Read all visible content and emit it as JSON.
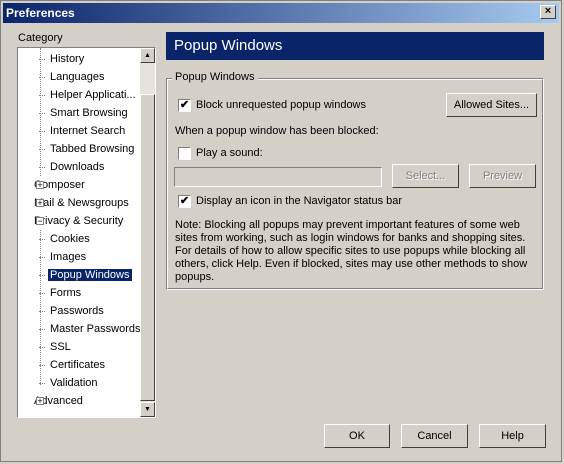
{
  "window": {
    "title": "Preferences",
    "close_glyph": "×"
  },
  "category_label": "Category",
  "tree": [
    {
      "label": "History",
      "level": 1,
      "selected": false
    },
    {
      "label": "Languages",
      "level": 1,
      "selected": false
    },
    {
      "label": "Helper Applicati...",
      "level": 1,
      "selected": false
    },
    {
      "label": "Smart Browsing",
      "level": 1,
      "selected": false
    },
    {
      "label": "Internet Search",
      "level": 1,
      "selected": false
    },
    {
      "label": "Tabbed Browsing",
      "level": 1,
      "selected": false
    },
    {
      "label": "Downloads",
      "level": 1,
      "selected": false
    },
    {
      "label": "Composer",
      "level": 0,
      "expander": "+",
      "selected": false
    },
    {
      "label": "Mail & Newsgroups",
      "level": 0,
      "expander": "+",
      "selected": false
    },
    {
      "label": "Privacy & Security",
      "level": 0,
      "expander": "−",
      "selected": false
    },
    {
      "label": "Cookies",
      "level": 1,
      "selected": false
    },
    {
      "label": "Images",
      "level": 1,
      "selected": false
    },
    {
      "label": "Popup Windows",
      "level": 1,
      "selected": true
    },
    {
      "label": "Forms",
      "level": 1,
      "selected": false
    },
    {
      "label": "Passwords",
      "level": 1,
      "selected": false
    },
    {
      "label": "Master Passwords",
      "level": 1,
      "selected": false
    },
    {
      "label": "SSL",
      "level": 1,
      "selected": false
    },
    {
      "label": "Certificates",
      "level": 1,
      "selected": false
    },
    {
      "label": "Validation",
      "level": 1,
      "selected": false
    },
    {
      "label": "Advanced",
      "level": 0,
      "expander": "+",
      "selected": false
    }
  ],
  "scroll": {
    "up_glyph": "▲",
    "down_glyph": "▼"
  },
  "panel": {
    "title": "Popup Windows",
    "group_title": "Popup Windows",
    "block_popups": {
      "label": "Block unrequested popup windows",
      "checked": true,
      "check_glyph": "✔"
    },
    "allowed_sites_button": "Allowed Sites...",
    "when_blocked_label": "When a popup window has been blocked:",
    "play_sound": {
      "label": "Play a sound:",
      "checked": false,
      "check_glyph": ""
    },
    "sound_path_value": "",
    "select_button": "Select...",
    "preview_button": "Preview",
    "display_icon": {
      "label": "Display an icon in the Navigator status bar",
      "checked": true,
      "check_glyph": "✔"
    },
    "note_lines": [
      "Note: Blocking all popups may prevent important features of some web",
      "sites from working, such as login windows for banks and shopping sites.",
      "For details of how to allow specific sites to use popups while blocking all",
      "others, click Help. Even if blocked, sites may use other methods to show",
      "popups."
    ]
  },
  "buttons": {
    "ok": "OK",
    "cancel": "Cancel",
    "help": "Help"
  }
}
